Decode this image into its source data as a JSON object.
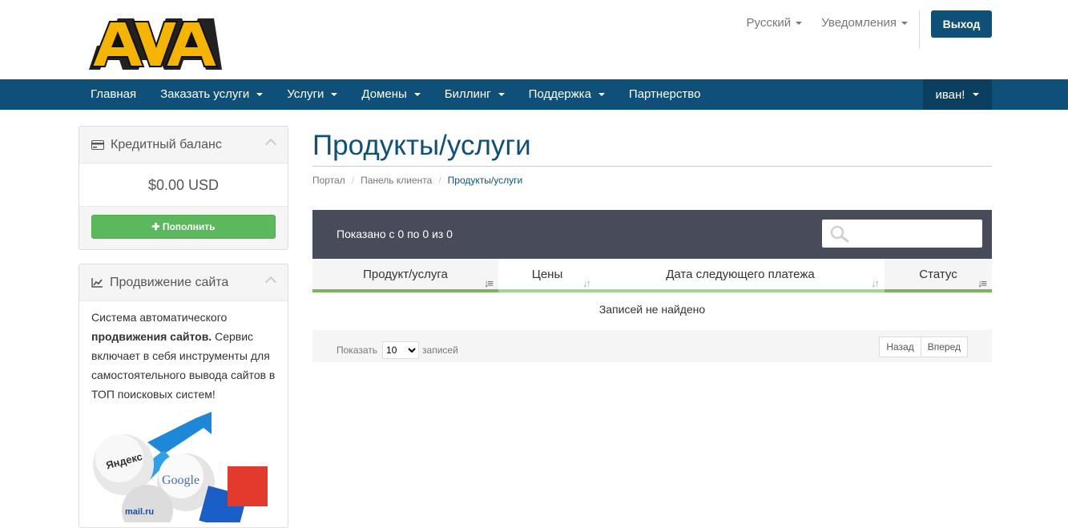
{
  "header": {
    "language_label": "Русский",
    "notifications_label": "Уведомления",
    "logout_label": "Выход"
  },
  "nav": {
    "items": [
      {
        "label": "Главная",
        "caret": false
      },
      {
        "label": "Заказать услуги",
        "caret": true
      },
      {
        "label": "Услуги",
        "caret": true
      },
      {
        "label": "Домены",
        "caret": true
      },
      {
        "label": "Биллинг",
        "caret": true
      },
      {
        "label": "Поддержка",
        "caret": true
      },
      {
        "label": "Партнерство",
        "caret": false
      }
    ],
    "user_label": "иван!"
  },
  "sidebar": {
    "credit": {
      "title": "Кредитный баланс",
      "amount": "$0.00 USD",
      "topup_label": "Пополнить"
    },
    "promo": {
      "title": "Продвижение сайта",
      "text_1": "Система автоматического",
      "text_bold": "продвижения сайтов.",
      "text_2": "Сервис включает в себя инструменты для самостоятельного вывода сайтов в ТОП поисковых систем!",
      "image_labels": [
        "Яндекс",
        "Google",
        "mail.ru"
      ]
    }
  },
  "main": {
    "title": "Продукты/услуги",
    "breadcrumb": [
      "Портал",
      "Панель клиента",
      "Продукты/услуги"
    ],
    "table": {
      "info": "Показано с 0 по 0 из 0",
      "columns": [
        "Продукт/услуга",
        "Цены",
        "Дата следующего платежа",
        "Статус"
      ],
      "empty_text": "Записей не найдено",
      "show_label": "Показать",
      "page_size": "10",
      "records_label": "записей",
      "prev_label": "Назад",
      "next_label": "Вперед"
    }
  },
  "colors": {
    "brand": "#0e5077",
    "table_header_bg": "#484c5a",
    "success": "#5cb85c"
  }
}
